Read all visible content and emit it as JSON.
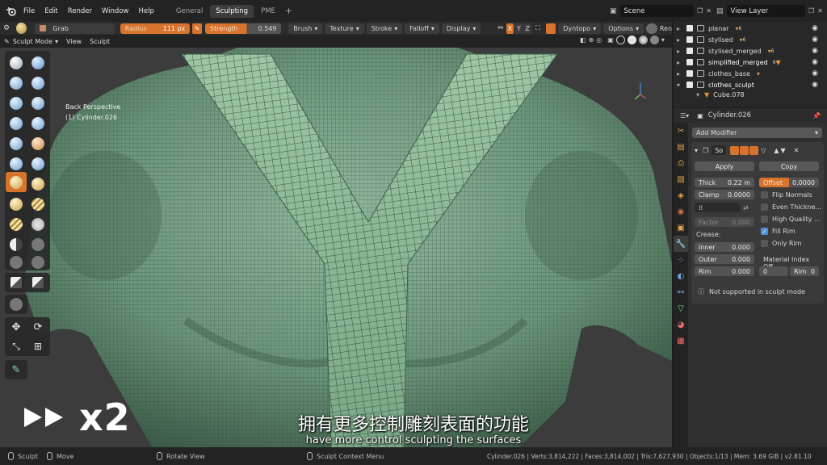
{
  "menubar": {
    "items": [
      "File",
      "Edit",
      "Render",
      "Window",
      "Help"
    ],
    "workspace_tabs": [
      "General",
      "Sculpting",
      "PME"
    ],
    "active_tab": "Sculpting",
    "scene": "Scene",
    "view_layer": "View Layer"
  },
  "tool_header": {
    "tool_name": "Grab",
    "radius_label": "Radius",
    "radius_value": "111 px",
    "strength_label": "Strength",
    "strength_value": "0.549",
    "menus": [
      "Brush",
      "Texture",
      "Stroke",
      "Falloff",
      "Display"
    ],
    "axes": [
      "X",
      "Y",
      "Z"
    ],
    "dyntopo": "Dyntopo",
    "options": "Options",
    "render_short": "Ren"
  },
  "mode_header": {
    "mode": "Sculpt Mode",
    "view": "View",
    "sculpt": "Sculpt"
  },
  "viewport": {
    "perspective": "Back Perspective",
    "object_line": "(1) Cylinder.026"
  },
  "outliner": {
    "rows": [
      {
        "name": "planar",
        "badge": "6"
      },
      {
        "name": "stylised",
        "badge": "6"
      },
      {
        "name": "stylised_merged",
        "badge": "6"
      },
      {
        "name": "simplified_merged",
        "badge": "6"
      },
      {
        "name": "clothes_base",
        "badge": ""
      },
      {
        "name": "clothes_sculpt",
        "badge": ""
      },
      {
        "name": "Cube.078",
        "badge": ""
      }
    ]
  },
  "properties": {
    "object_name": "Cylinder.026",
    "add_modifier": "Add Modifier",
    "modifier_short": "So",
    "apply": "Apply",
    "copy": "Copy",
    "thick_label": "Thick",
    "thick_value": "0.22 m",
    "offset_label": "Offset",
    "offset_value": "0.0000",
    "clamp_label": "Clamp",
    "clamp_value": "0.0000",
    "flip_normals": "Flip Normals",
    "even_thickness": "Even Thickne...",
    "high_quality": "High Quality ...",
    "fill_rim": "Fill Rim",
    "only_rim": "Only Rim",
    "factor_label": "Factor",
    "factor_value": "0.000",
    "crease": "Crease:",
    "inner_label": "Inner",
    "inner_value": "0.000",
    "outer_label": "Outer",
    "outer_value": "0.000",
    "rim_label": "Rim",
    "rim_value": "0.000",
    "material_index": "Material Index Off...",
    "mat_value": "0",
    "rim2_label": "Rim",
    "rim2_value": "0",
    "not_supported": "Not supported in sculpt mode"
  },
  "statusbar": {
    "sculpt": "Sculpt",
    "move": "Move",
    "rotate_view": "Rotate View",
    "context_menu": "Sculpt Context Menu",
    "stats": "Cylinder.026 | Verts:3,814,222 | Faces:3,814,002 | Tris:7,627,930 | Objects:1/13 | Mem: 3.69 GiB | v2.81.10"
  },
  "overlay": {
    "speed": "x2",
    "subtitle_cn": "拥有更多控制雕刻表面的功能",
    "subtitle_en": "have more control sculpting the surfaces"
  },
  "colors": {
    "accent": "#d7732c",
    "mesh": "#6f9a82",
    "strap": "#86b292",
    "background": "#1d1d1d"
  }
}
